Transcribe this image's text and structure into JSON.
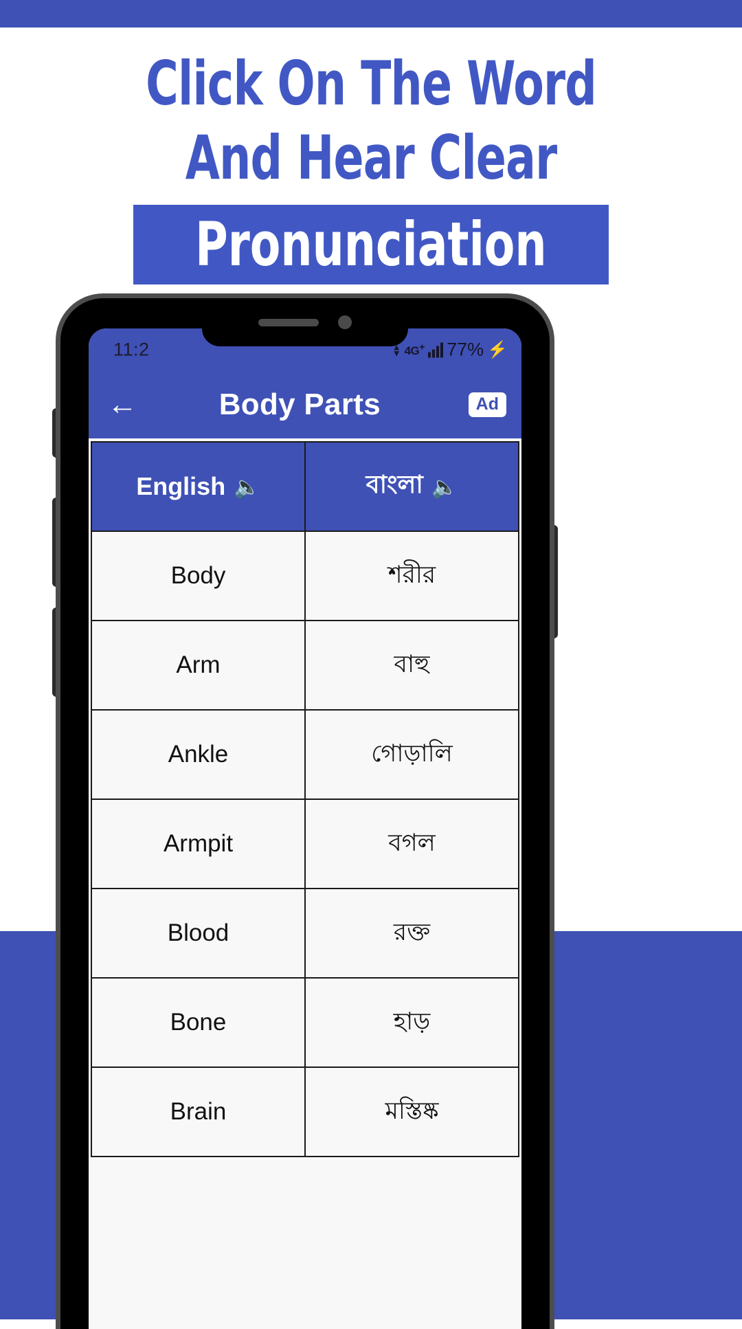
{
  "promo": {
    "line1": "Click On The Word",
    "line2": "And Hear Clear",
    "line3": "Pronunciation",
    "text_color": "#4158c4",
    "highlight_bg": "#4158c4",
    "highlight_text_color": "#ffffff",
    "band_color": "#3f51b5"
  },
  "phone": {
    "status_bar": {
      "time": "11:2",
      "network": "4G",
      "network_plus": "+",
      "battery": "77%",
      "charging_icon": "bolt-icon"
    },
    "app_bar": {
      "back_icon": "back-arrow-icon",
      "title": "Body Parts",
      "ad_label": "Ad"
    },
    "table": {
      "columns": [
        {
          "label": "English",
          "speaker_icon": "speaker-icon"
        },
        {
          "label": "বাংলা",
          "speaker_icon": "speaker-icon"
        }
      ],
      "rows": [
        {
          "english": "Body",
          "bangla": "শরীর"
        },
        {
          "english": "Arm",
          "bangla": "বাহু"
        },
        {
          "english": "Ankle",
          "bangla": "গোড়ালি"
        },
        {
          "english": "Armpit",
          "bangla": "বগল"
        },
        {
          "english": "Blood",
          "bangla": "রক্ত"
        },
        {
          "english": "Bone",
          "bangla": "হাড়"
        },
        {
          "english": "Brain",
          "bangla": "মস্তিষ্ক"
        }
      ]
    }
  }
}
